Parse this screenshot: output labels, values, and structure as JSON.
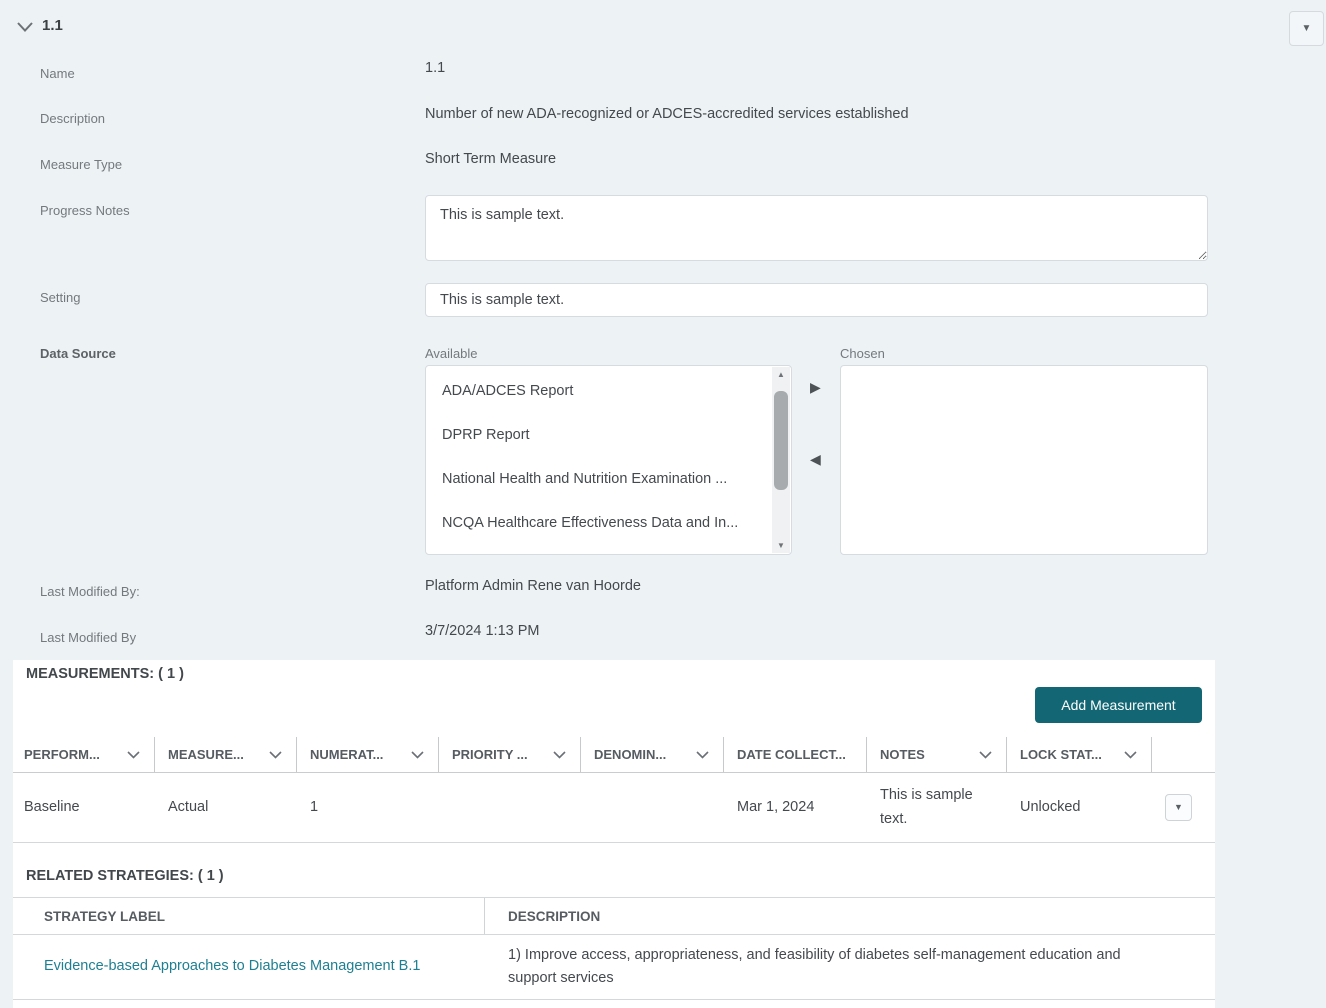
{
  "colors": {
    "page_bg": "#edf2f5",
    "panel_bg": "#ffffff",
    "accent_teal": "#136774",
    "link_teal": "#1e7f92",
    "label_gray": "#74797e",
    "text_gray": "#44494e"
  },
  "glyphs": {
    "down_triangle": "▼",
    "up_triangle": "▲",
    "right_triangle": "▶",
    "left_triangle": "◀"
  },
  "header": {
    "title": "1.1"
  },
  "form": {
    "name_label": "Name",
    "name_value": "1.1",
    "description_label": "Description",
    "description_value": "Number of new ADA-recognized or ADCES-accredited services established",
    "measure_type_label": "Measure Type",
    "measure_type_value": "Short Term Measure",
    "progress_notes_label": "Progress Notes",
    "progress_notes_value": "This is sample text.",
    "setting_label": "Setting",
    "setting_value": "This is sample text.",
    "data_source": {
      "label": "Data Source",
      "available_label": "Available",
      "chosen_label": "Chosen",
      "available_items": [
        "ADA/ADCES Report",
        "DPRP Report",
        "National Health and Nutrition Examination ...",
        "NCQA Healthcare Effectiveness Data and In..."
      ],
      "chosen_items": []
    },
    "last_modified_by_label": "Last Modified By:",
    "last_modified_by_value": "Platform Admin Rene van Hoorde",
    "last_modified_date_label": "Last Modified By",
    "last_modified_date_value": "3/7/2024 1:13 PM"
  },
  "measurements": {
    "title": "MEASUREMENTS: ( 1 )",
    "add_button_label": "Add Measurement",
    "columns": [
      {
        "label": "PERFORM..."
      },
      {
        "label": "MEASURE..."
      },
      {
        "label": "NUMERAT..."
      },
      {
        "label": "PRIORITY ..."
      },
      {
        "label": "DENOMIN..."
      },
      {
        "label": "DATE COLLECT..."
      },
      {
        "label": "NOTES"
      },
      {
        "label": "LOCK STAT..."
      }
    ],
    "row": {
      "performance": "Baseline",
      "measure": "Actual",
      "numerator": "1",
      "priority": "",
      "denominator": "",
      "date_collected": "Mar 1, 2024",
      "notes": "This is sample text.",
      "lock_status": "Unlocked"
    }
  },
  "related_strategies": {
    "title": "RELATED STRATEGIES: ( 1 )",
    "strategy_label_column": "STRATEGY LABEL",
    "description_column": "DESCRIPTION",
    "row": {
      "label": "Evidence-based Approaches to Diabetes Management B.1",
      "description": "1) Improve access, appropriateness, and feasibility of diabetes self-management education and support services"
    }
  }
}
